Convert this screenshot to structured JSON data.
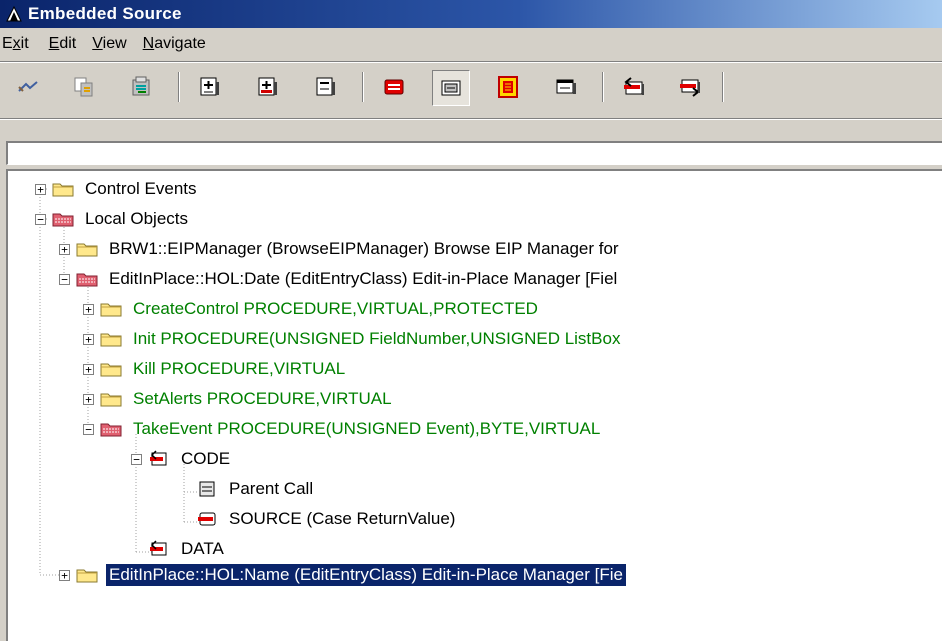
{
  "window": {
    "title": "Embedded Source"
  },
  "menu": [
    {
      "label_pre": "E",
      "label_ul": "x",
      "label_post": "it"
    },
    {
      "label_pre": "",
      "label_ul": "E",
      "label_post": "dit"
    },
    {
      "label_pre": "",
      "label_ul": "V",
      "label_post": "iew"
    },
    {
      "label_pre": "",
      "label_ul": "N",
      "label_post": "avigate"
    }
  ],
  "path_field": {
    "value": ""
  },
  "tree": [
    {
      "label": "Control Events",
      "icon": "folder-closed-icon",
      "expander": "+"
    },
    {
      "label": "Local Objects",
      "icon": "folder-open-red-icon",
      "expander": "-"
    },
    {
      "label": "BRW1::EIPManager  (BrowseEIPManager) Browse EIP Manager for",
      "icon": "folder-closed-icon",
      "expander": "+"
    },
    {
      "label": "EditInPlace::HOL:Date  (EditEntryClass)  Edit-in-Place Manager  [Fiel",
      "icon": "folder-open-red-icon",
      "expander": "-"
    },
    {
      "label": "CreateControl PROCEDURE,VIRTUAL,PROTECTED",
      "icon": "folder-closed-icon",
      "expander": "+"
    },
    {
      "label": "Init PROCEDURE(UNSIGNED FieldNumber,UNSIGNED ListBox",
      "icon": "folder-closed-icon",
      "expander": "+"
    },
    {
      "label": "Kill PROCEDURE,VIRTUAL",
      "icon": "folder-closed-icon",
      "expander": "+"
    },
    {
      "label": "SetAlerts PROCEDURE,VIRTUAL",
      "icon": "folder-closed-icon",
      "expander": "+"
    },
    {
      "label": "TakeEvent PROCEDURE(UNSIGNED Event),BYTE,VIRTUAL",
      "icon": "folder-open-red-icon",
      "expander": "-"
    },
    {
      "label": "CODE",
      "icon": "code-embed-icon",
      "expander": "-"
    },
    {
      "label": "Parent Call",
      "icon": "parent-call-icon",
      "expander": ""
    },
    {
      "label": "SOURCE (Case ReturnValue)",
      "icon": "source-embed-icon",
      "expander": ""
    },
    {
      "label": "DATA",
      "icon": "data-embed-icon",
      "expander": ""
    },
    {
      "label": "EditInPlace::HOL:Name  (EditEntryClass)  Edit-in-Place Manager  [Fie",
      "icon": "folder-closed-icon",
      "expander": "+"
    }
  ],
  "colors": {
    "selection": "#0a246a",
    "procedure_text": "#008000",
    "titlebar": "#0a246a"
  }
}
